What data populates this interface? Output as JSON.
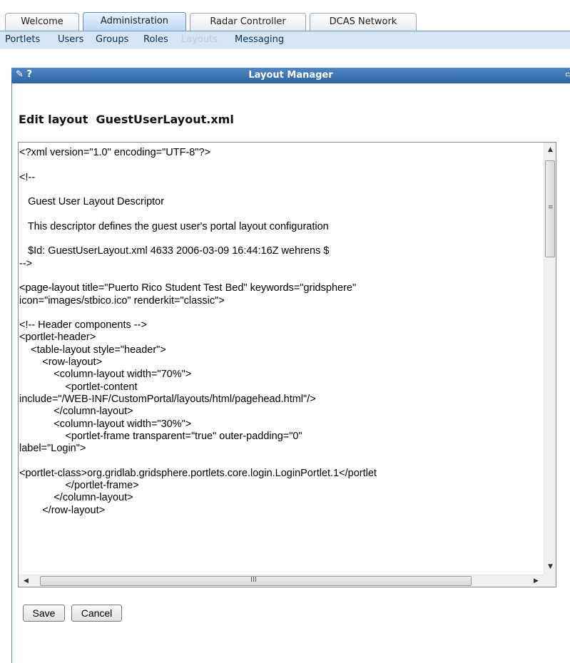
{
  "tabs": [
    {
      "label": "Welcome"
    },
    {
      "label": "Administration"
    },
    {
      "label": "Radar Controller"
    },
    {
      "label": "DCAS Network"
    }
  ],
  "subnav": [
    "Portlets",
    "Users",
    "Groups",
    "Roles",
    "Layouts",
    "Messaging"
  ],
  "portlet": {
    "title": "Layout Manager",
    "left_icons": "✎ ?",
    "right_icons": "▭ ☐"
  },
  "edit": {
    "label": "Edit layout",
    "filename": "GuestUserLayout.xml"
  },
  "code_lines": [
    "<?xml version=\"1.0\" encoding=\"UTF-8\"?>",
    "",
    "<!--",
    "",
    "   Guest User Layout Descriptor",
    "",
    "   This descriptor defines the guest user's portal layout configuration",
    "",
    "   $Id: GuestUserLayout.xml 4633 2006-03-09 16:44:16Z wehrens $",
    "-->",
    "",
    "<page-layout title=\"Puerto Rico Student Test Bed\" keywords=\"gridsphere\"",
    "icon=\"images/stbico.ico\" renderkit=\"classic\">",
    "",
    "<!-- Header components -->",
    "<portlet-header>",
    "    <table-layout style=\"header\">",
    "        <row-layout>",
    "            <column-layout width=\"70%\">",
    "                <portlet-content",
    "include=\"/WEB-INF/CustomPortal/layouts/html/pagehead.html\"/>",
    "            </column-layout>",
    "            <column-layout width=\"30%\">",
    "                <portlet-frame transparent=\"true\" outer-padding=\"0\"",
    "label=\"Login\">",
    "",
    "<portlet-class>org.gridlab.gridsphere.portlets.core.login.LoginPortlet.1</portlet",
    "                </portlet-frame>",
    "            </column-layout>",
    "        </row-layout>"
  ],
  "buttons": {
    "save": "Save",
    "cancel": "Cancel"
  }
}
